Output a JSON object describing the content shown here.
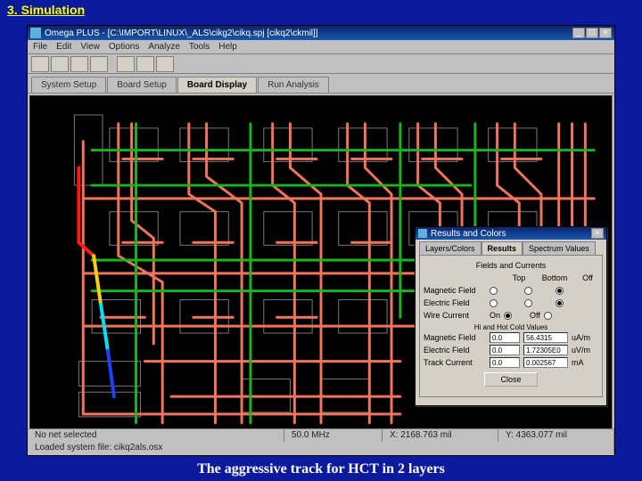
{
  "slide": {
    "title": "3. Simulation",
    "caption": "The aggressive track for HCT in 2 layers"
  },
  "app": {
    "title": "Omega PLUS - [C:\\IMPORT\\LINUX\\_ALS\\cikg2\\cikq.spj [cikq2\\ckmil]]",
    "menus": [
      "File",
      "Edit",
      "View",
      "Options",
      "Analyze",
      "Tools",
      "Help"
    ],
    "tabs": [
      "System Setup",
      "Board Setup",
      "Board Display",
      "Run Analysis"
    ],
    "active_tab": 2,
    "status": {
      "sel": "No net selected",
      "freq": "50.0 MHz",
      "x": "X: 2168.763 mil",
      "y": "Y: 4363.077 mil",
      "loaded": "Loaded system file: cikq2als.osx"
    }
  },
  "dialog": {
    "title": "Results and Colors",
    "tabs": [
      "Layers/Colors",
      "Results",
      "Spectrum Values"
    ],
    "active_tab": 1,
    "section1": "Fields and Currents",
    "top_off": "Top",
    "bottom_off": "Bottom",
    "off_lbl": "Off",
    "rows1": [
      {
        "label": "Magnetic Field",
        "sel": 1
      },
      {
        "label": "Electric Field",
        "sel": 0
      },
      {
        "label": "Wire Current",
        "on": "On",
        "off": "Off"
      }
    ],
    "section2": "Hi and Hot Cold Values",
    "rows2": [
      {
        "label": "Magnetic Field",
        "lo": "0.0",
        "hi": "56.4315",
        "unit": "uA/m"
      },
      {
        "label": "Electric Field",
        "lo": "0.0",
        "hi": "1.72305E0",
        "unit": "uV/m"
      },
      {
        "label": "Track Current",
        "lo": "0.0",
        "hi": "0.002567",
        "unit": "mA"
      }
    ],
    "close": "Close"
  },
  "win_btns": {
    "min": "_",
    "max": "□",
    "close": "×"
  }
}
